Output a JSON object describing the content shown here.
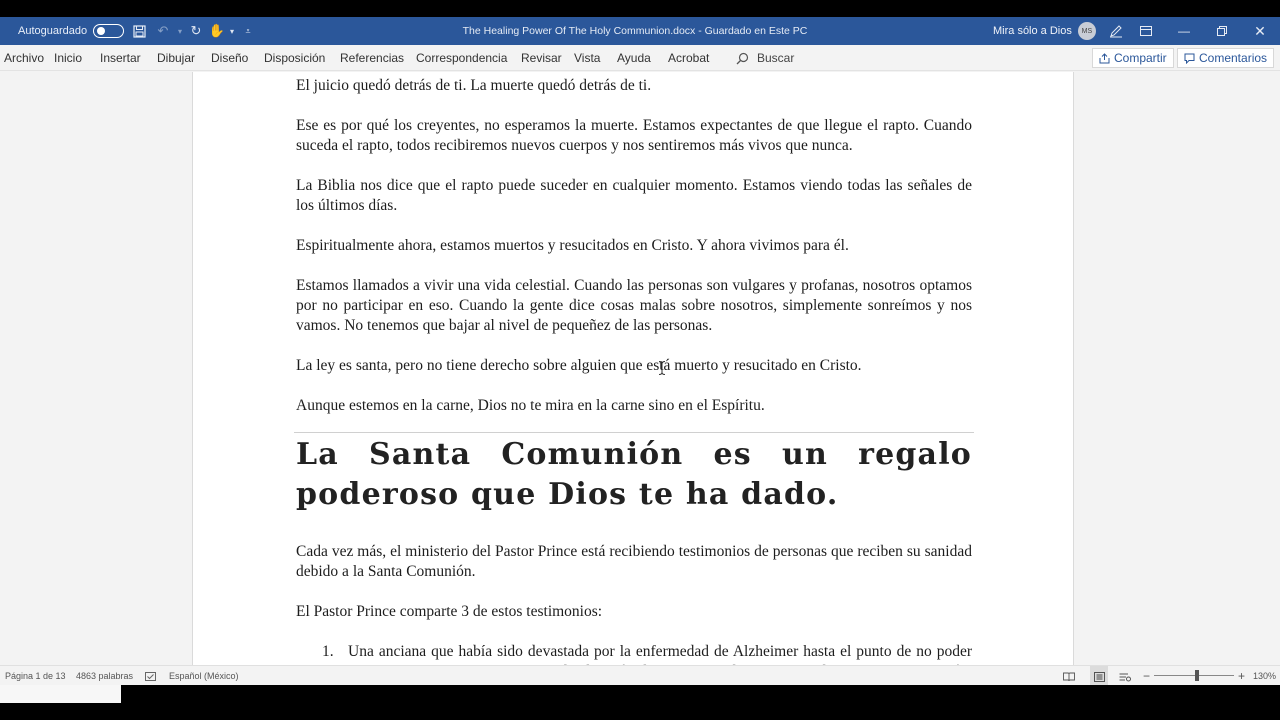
{
  "titlebar": {
    "autosave_label": "Autoguardado",
    "doc_title": "The Healing Power Of The Holy Communion.docx  -  Guardado en Este PC",
    "user_name": "Mira sólo a Dios",
    "avatar_initials": "MS"
  },
  "menu": {
    "items": [
      "Archivo",
      "Inicio",
      "Insertar",
      "Dibujar",
      "Diseño",
      "Disposición",
      "Referencias",
      "Correspondencia",
      "Revisar",
      "Vista",
      "Ayuda",
      "Acrobat"
    ],
    "search_label": "Buscar",
    "share_label": "Compartir",
    "comments_label": "Comentarios"
  },
  "document": {
    "paragraphs_top": [
      "El juicio quedó detrás de ti. La muerte quedó detrás de ti.",
      "Ese es por qué los creyentes, no esperamos la muerte. Estamos expectantes de que llegue el rapto. Cuando suceda el rapto, todos recibiremos nuevos cuerpos y nos sentiremos más vivos que nunca.",
      "La Biblia nos dice que el rapto puede suceder en cualquier momento. Estamos viendo todas las señales de los últimos días.",
      "Espiritualmente ahora, estamos muertos y resucitados en Cristo. Y ahora vivimos para él.",
      "Estamos llamados a vivir una vida celestial. Cuando las personas son vulgares y profanas, nosotros optamos por no participar en eso. Cuando la gente dice cosas malas sobre nosotros, simplemente sonreímos y nos vamos. No tenemos que bajar al nivel de pequeñez de las personas.",
      "La ley es santa, pero no tiene derecho sobre alguien que está muerto y resucitado en Cristo.",
      "Aunque estemos en la carne, Dios no te mira en la carne sino en el Espíritu."
    ],
    "heading": "La Santa Comunión es un regalo poderoso que Dios te ha dado.",
    "paragraphs_bottom": [
      "Cada vez más, el ministerio del Pastor Prince está recibiendo testimonios de personas que reciben su sanidad debido a la Santa Comunión.",
      "El Pastor Prince comparte 3 de estos testimonios:"
    ],
    "list_number": "1.",
    "list_item": "Una anciana que había sido devastada por la enfermedad de Alzheimer hasta el punto de no poder reconocer a su familia fue curada después de 3 noches de participar de la Santa Comunión, recibiendo su sanidad completa y pudiendo reconocer nuevamente a sus familiares."
  },
  "status": {
    "page": "Página 1 de 13",
    "words": "4863 palabras",
    "language": "Español (México)",
    "zoom": "130%"
  }
}
